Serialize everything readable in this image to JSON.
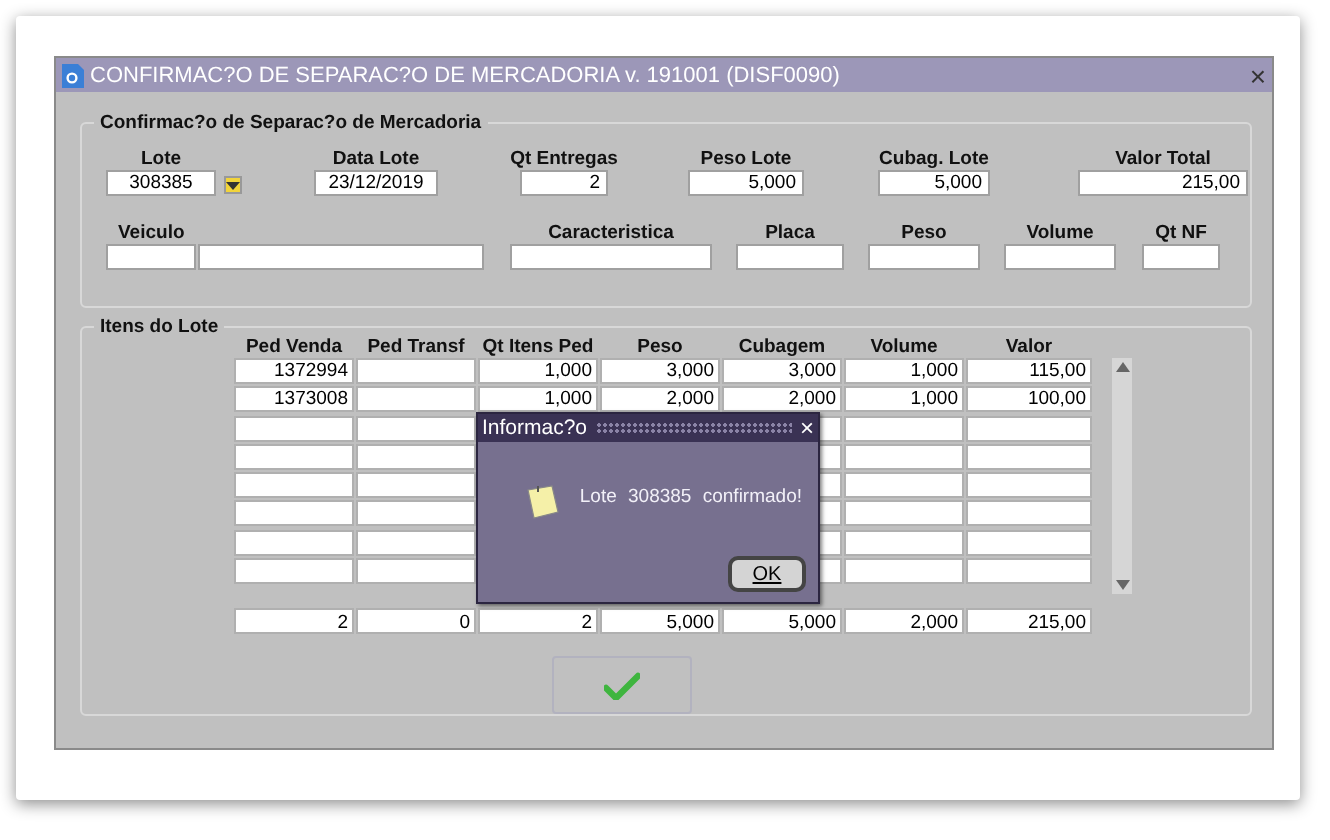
{
  "window": {
    "title": "CONFIRMAC?O DE SEPARAC?O DE MERCADORIA v. 191001 (DISF0090)",
    "close": "×"
  },
  "header_frame": {
    "title": "Confirmac?o de Separac?o de Mercadoria",
    "fields": [
      {
        "label": "Lote",
        "value": "308385"
      },
      {
        "label": "Data Lote",
        "value": "23/12/2019"
      },
      {
        "label": "Qt Entregas",
        "value": "2"
      },
      {
        "label": "Peso Lote",
        "value": "5,000"
      },
      {
        "label": "Cubag. Lote",
        "value": "5,000"
      },
      {
        "label": "Valor Total",
        "value": "215,00"
      }
    ],
    "vehicle_fields": [
      {
        "label": "Veiculo"
      },
      {
        "label": "Caracteristica"
      },
      {
        "label": "Placa"
      },
      {
        "label": "Peso"
      },
      {
        "label": "Volume"
      },
      {
        "label": "Qt NF"
      }
    ]
  },
  "items_frame": {
    "title": "Itens do Lote",
    "columns": [
      "Ped Venda",
      "Ped Transf",
      "Qt Itens Ped",
      "Peso",
      "Cubagem",
      "Volume",
      "Valor"
    ],
    "rows": [
      {
        "ped_venda": "1372994",
        "qt_itens_ped": "1,000",
        "peso": "3,000",
        "cubagem": "3,000",
        "volume": "1,000",
        "valor": "115,00"
      },
      {
        "ped_venda": "1373008",
        "qt_itens_ped": "1,000",
        "peso": "2,000",
        "cubagem": "2,000",
        "volume": "1,000",
        "valor": "100,00"
      }
    ],
    "totals": [
      "2",
      "0",
      "2",
      "5,000",
      "5,000",
      "2,000",
      "215,00"
    ]
  },
  "dialog": {
    "title": "Informac?o",
    "close": "×",
    "message": "Lote 308385 confirmado!",
    "button": "OK"
  }
}
